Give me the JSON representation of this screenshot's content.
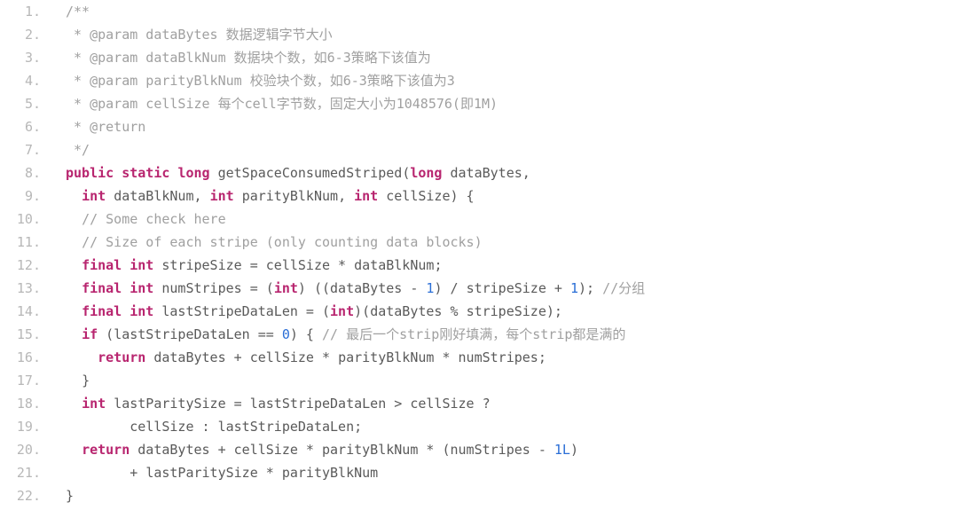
{
  "code": {
    "lines": [
      {
        "n": "1.",
        "indent": 0,
        "tokens": [
          {
            "k": "c",
            "t": "/**"
          }
        ]
      },
      {
        "n": "2.",
        "indent": 0,
        "tokens": [
          {
            "k": "c",
            "t": " * @param dataBytes 数据逻辑字节大小"
          }
        ]
      },
      {
        "n": "3.",
        "indent": 0,
        "tokens": [
          {
            "k": "c",
            "t": " * @param dataBlkNum 数据块个数，如6-3策略下该值为"
          }
        ]
      },
      {
        "n": "4.",
        "indent": 0,
        "tokens": [
          {
            "k": "c",
            "t": " * @param parityBlkNum 校验块个数，如6-3策略下该值为3"
          }
        ]
      },
      {
        "n": "5.",
        "indent": 0,
        "tokens": [
          {
            "k": "c",
            "t": " * @param cellSize 每个cell字节数，固定大小为1048576(即1M)"
          }
        ]
      },
      {
        "n": "6.",
        "indent": 0,
        "tokens": [
          {
            "k": "c",
            "t": " * @return"
          }
        ]
      },
      {
        "n": "7.",
        "indent": 0,
        "tokens": [
          {
            "k": "c",
            "t": " */"
          }
        ]
      },
      {
        "n": "8.",
        "indent": 0,
        "tokens": [
          {
            "k": "kw",
            "t": "public"
          },
          {
            "k": "pun",
            "t": " "
          },
          {
            "k": "kw",
            "t": "static"
          },
          {
            "k": "pun",
            "t": " "
          },
          {
            "k": "ty",
            "t": "long"
          },
          {
            "k": "pun",
            "t": " "
          },
          {
            "k": "fn",
            "t": "getSpaceConsumedStriped"
          },
          {
            "k": "pun",
            "t": "("
          },
          {
            "k": "ty",
            "t": "long"
          },
          {
            "k": "pun",
            "t": " "
          },
          {
            "k": "id",
            "t": "dataBytes"
          },
          {
            "k": "pun",
            "t": ","
          }
        ]
      },
      {
        "n": "9.",
        "indent": 2,
        "tokens": [
          {
            "k": "ty",
            "t": "int"
          },
          {
            "k": "pun",
            "t": " "
          },
          {
            "k": "id",
            "t": "dataBlkNum"
          },
          {
            "k": "pun",
            "t": ", "
          },
          {
            "k": "ty",
            "t": "int"
          },
          {
            "k": "pun",
            "t": " "
          },
          {
            "k": "id",
            "t": "parityBlkNum"
          },
          {
            "k": "pun",
            "t": ", "
          },
          {
            "k": "ty",
            "t": "int"
          },
          {
            "k": "pun",
            "t": " "
          },
          {
            "k": "id",
            "t": "cellSize"
          },
          {
            "k": "pun",
            "t": ") {"
          }
        ]
      },
      {
        "n": "10.",
        "indent": 2,
        "tokens": [
          {
            "k": "c",
            "t": "// Some check here"
          }
        ]
      },
      {
        "n": "11.",
        "indent": 2,
        "tokens": [
          {
            "k": "c",
            "t": "// Size of each stripe (only counting data blocks)"
          }
        ]
      },
      {
        "n": "12.",
        "indent": 2,
        "tokens": [
          {
            "k": "kw",
            "t": "final"
          },
          {
            "k": "pun",
            "t": " "
          },
          {
            "k": "ty",
            "t": "int"
          },
          {
            "k": "pun",
            "t": " "
          },
          {
            "k": "id",
            "t": "stripeSize"
          },
          {
            "k": "pun",
            "t": " = "
          },
          {
            "k": "id",
            "t": "cellSize"
          },
          {
            "k": "pun",
            "t": " * "
          },
          {
            "k": "id",
            "t": "dataBlkNum"
          },
          {
            "k": "pun",
            "t": ";"
          }
        ]
      },
      {
        "n": "13.",
        "indent": 2,
        "tokens": [
          {
            "k": "kw",
            "t": "final"
          },
          {
            "k": "pun",
            "t": " "
          },
          {
            "k": "ty",
            "t": "int"
          },
          {
            "k": "pun",
            "t": " "
          },
          {
            "k": "id",
            "t": "numStripes"
          },
          {
            "k": "pun",
            "t": " = ("
          },
          {
            "k": "ty",
            "t": "int"
          },
          {
            "k": "pun",
            "t": ") (("
          },
          {
            "k": "id",
            "t": "dataBytes"
          },
          {
            "k": "pun",
            "t": " - "
          },
          {
            "k": "num",
            "t": "1"
          },
          {
            "k": "pun",
            "t": ") / "
          },
          {
            "k": "id",
            "t": "stripeSize"
          },
          {
            "k": "pun",
            "t": " + "
          },
          {
            "k": "num",
            "t": "1"
          },
          {
            "k": "pun",
            "t": "); "
          },
          {
            "k": "c",
            "t": "//分组"
          }
        ]
      },
      {
        "n": "14.",
        "indent": 2,
        "tokens": [
          {
            "k": "kw",
            "t": "final"
          },
          {
            "k": "pun",
            "t": " "
          },
          {
            "k": "ty",
            "t": "int"
          },
          {
            "k": "pun",
            "t": " "
          },
          {
            "k": "id",
            "t": "lastStripeDataLen"
          },
          {
            "k": "pun",
            "t": " = ("
          },
          {
            "k": "ty",
            "t": "int"
          },
          {
            "k": "pun",
            "t": ")("
          },
          {
            "k": "id",
            "t": "dataBytes"
          },
          {
            "k": "pun",
            "t": " % "
          },
          {
            "k": "id",
            "t": "stripeSize"
          },
          {
            "k": "pun",
            "t": ");"
          }
        ]
      },
      {
        "n": "15.",
        "indent": 2,
        "tokens": [
          {
            "k": "kw",
            "t": "if"
          },
          {
            "k": "pun",
            "t": " ("
          },
          {
            "k": "id",
            "t": "lastStripeDataLen"
          },
          {
            "k": "pun",
            "t": " == "
          },
          {
            "k": "num",
            "t": "0"
          },
          {
            "k": "pun",
            "t": ") { "
          },
          {
            "k": "c",
            "t": "// 最后一个strip刚好填满，每个strip都是满的"
          }
        ]
      },
      {
        "n": "16.",
        "indent": 4,
        "tokens": [
          {
            "k": "kw",
            "t": "return"
          },
          {
            "k": "pun",
            "t": " "
          },
          {
            "k": "id",
            "t": "dataBytes"
          },
          {
            "k": "pun",
            "t": " + "
          },
          {
            "k": "id",
            "t": "cellSize"
          },
          {
            "k": "pun",
            "t": " * "
          },
          {
            "k": "id",
            "t": "parityBlkNum"
          },
          {
            "k": "pun",
            "t": " * "
          },
          {
            "k": "id",
            "t": "numStripes"
          },
          {
            "k": "pun",
            "t": ";"
          }
        ]
      },
      {
        "n": "17.",
        "indent": 2,
        "tokens": [
          {
            "k": "pun",
            "t": "}"
          }
        ]
      },
      {
        "n": "18.",
        "indent": 2,
        "tokens": [
          {
            "k": "ty",
            "t": "int"
          },
          {
            "k": "pun",
            "t": " "
          },
          {
            "k": "id",
            "t": "lastParitySize"
          },
          {
            "k": "pun",
            "t": " = "
          },
          {
            "k": "id",
            "t": "lastStripeDataLen"
          },
          {
            "k": "pun",
            "t": " > "
          },
          {
            "k": "id",
            "t": "cellSize"
          },
          {
            "k": "pun",
            "t": " ?"
          }
        ]
      },
      {
        "n": "19.",
        "indent": 8,
        "tokens": [
          {
            "k": "id",
            "t": "cellSize"
          },
          {
            "k": "pun",
            "t": " : "
          },
          {
            "k": "id",
            "t": "lastStripeDataLen"
          },
          {
            "k": "pun",
            "t": ";"
          }
        ]
      },
      {
        "n": "20.",
        "indent": 2,
        "tokens": [
          {
            "k": "kw",
            "t": "return"
          },
          {
            "k": "pun",
            "t": " "
          },
          {
            "k": "id",
            "t": "dataBytes"
          },
          {
            "k": "pun",
            "t": " + "
          },
          {
            "k": "id",
            "t": "cellSize"
          },
          {
            "k": "pun",
            "t": " * "
          },
          {
            "k": "id",
            "t": "parityBlkNum"
          },
          {
            "k": "pun",
            "t": " * ("
          },
          {
            "k": "id",
            "t": "numStripes"
          },
          {
            "k": "pun",
            "t": " - "
          },
          {
            "k": "num",
            "t": "1L"
          },
          {
            "k": "pun",
            "t": ")"
          }
        ]
      },
      {
        "n": "21.",
        "indent": 8,
        "tokens": [
          {
            "k": "pun",
            "t": "+ "
          },
          {
            "k": "id",
            "t": "lastParitySize"
          },
          {
            "k": "pun",
            "t": " * "
          },
          {
            "k": "id",
            "t": "parityBlkNum"
          }
        ]
      },
      {
        "n": "22.",
        "indent": 0,
        "tokens": [
          {
            "k": "pun",
            "t": "}"
          }
        ]
      }
    ]
  }
}
